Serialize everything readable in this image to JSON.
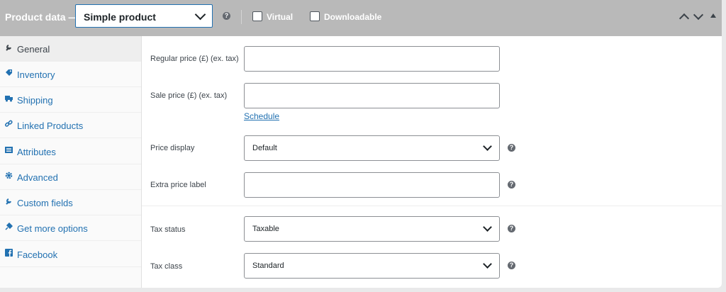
{
  "header": {
    "title": "Product data —",
    "product_type": "Simple product",
    "help_glyph": "?",
    "virtual_label": "Virtual",
    "downloadable_label": "Downloadable"
  },
  "sidebar": {
    "items": [
      {
        "label": "General",
        "icon": "wrench-icon",
        "active": true
      },
      {
        "label": "Inventory",
        "icon": "tag-icon"
      },
      {
        "label": "Shipping",
        "icon": "truck-icon"
      },
      {
        "label": "Linked Products",
        "icon": "link-icon"
      },
      {
        "label": "Attributes",
        "icon": "list-icon"
      },
      {
        "label": "Advanced",
        "icon": "gear-icon"
      },
      {
        "label": "Custom fields",
        "icon": "wrench-icon"
      },
      {
        "label": "Get more options",
        "icon": "plugin-icon"
      },
      {
        "label": "Facebook",
        "icon": "facebook-icon"
      }
    ]
  },
  "fields": {
    "regular_price": {
      "label": "Regular price (£) (ex. tax)",
      "value": ""
    },
    "sale_price": {
      "label": "Sale price (£) (ex. tax)",
      "value": ""
    },
    "schedule_link": "Schedule",
    "price_display": {
      "label": "Price display",
      "value": "Default"
    },
    "extra_price_label": {
      "label": "Extra price label",
      "value": ""
    },
    "tax_status": {
      "label": "Tax status",
      "value": "Taxable"
    },
    "tax_class": {
      "label": "Tax class",
      "value": "Standard"
    }
  },
  "colors": {
    "header_bg": "#b9b9b9",
    "link": "#2271b1",
    "focus_border": "#2271b1"
  }
}
